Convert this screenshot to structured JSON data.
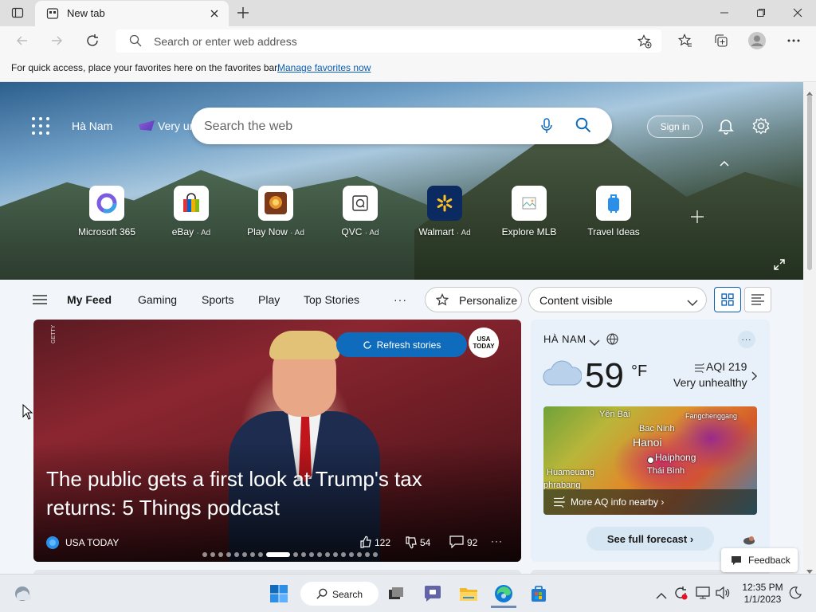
{
  "browser": {
    "tab_title": "New tab",
    "address_placeholder": "Search or enter web address",
    "favorites_message": "For quick access, place your favorites here on the favorites bar.",
    "favorites_link": "Manage favorites now"
  },
  "hero": {
    "location": "Hà Nam",
    "aqi_short": "Very unh...",
    "search_placeholder": "Search the web",
    "sign_in": "Sign in",
    "tiles": [
      {
        "label": "Microsoft 365",
        "ad": ""
      },
      {
        "label": "eBay",
        "ad": "· Ad"
      },
      {
        "label": "Play Now",
        "ad": "· Ad"
      },
      {
        "label": "QVC",
        "ad": "· Ad"
      },
      {
        "label": "Walmart",
        "ad": "· Ad"
      },
      {
        "label": "Explore MLB",
        "ad": ""
      },
      {
        "label": "Travel Ideas",
        "ad": ""
      }
    ]
  },
  "feed_nav": {
    "items": [
      "My Feed",
      "Gaming",
      "Sports",
      "Play",
      "Top Stories"
    ],
    "more": "···",
    "personalize": "Personalize",
    "content_select": "Content visible"
  },
  "article": {
    "refresh": "Refresh stories",
    "badge_line1": "USA",
    "badge_line2": "TODAY",
    "getty": "GETTY",
    "headline": "The public gets a first look at Trump's tax returns: 5 Things podcast",
    "source": "USA TODAY",
    "likes": "122",
    "dislikes": "54",
    "comments": "92",
    "more": "···",
    "slide_count": 20,
    "active_slide": 8
  },
  "weather": {
    "location": "HÀ NAM",
    "temp": "59",
    "unit": "°F",
    "aqi": "AQI 219",
    "aqi_status": "Very unhealthy",
    "map_cities": [
      "Yên Bái",
      "Bac Ninh",
      "Fangchenggang",
      "Hanoi",
      "Haiphong",
      "Huameuang",
      "Thái Bình",
      "phrabang"
    ],
    "map_link": "More AQ info nearby ›",
    "forecast": "See full forecast ›",
    "more": "···"
  },
  "feedback": "Feedback",
  "taskbar": {
    "search": "Search",
    "time": "12:35 PM",
    "date": "1/1/2023"
  },
  "colors": {
    "accent": "#0f6cbd",
    "link": "#0a5fb4"
  }
}
